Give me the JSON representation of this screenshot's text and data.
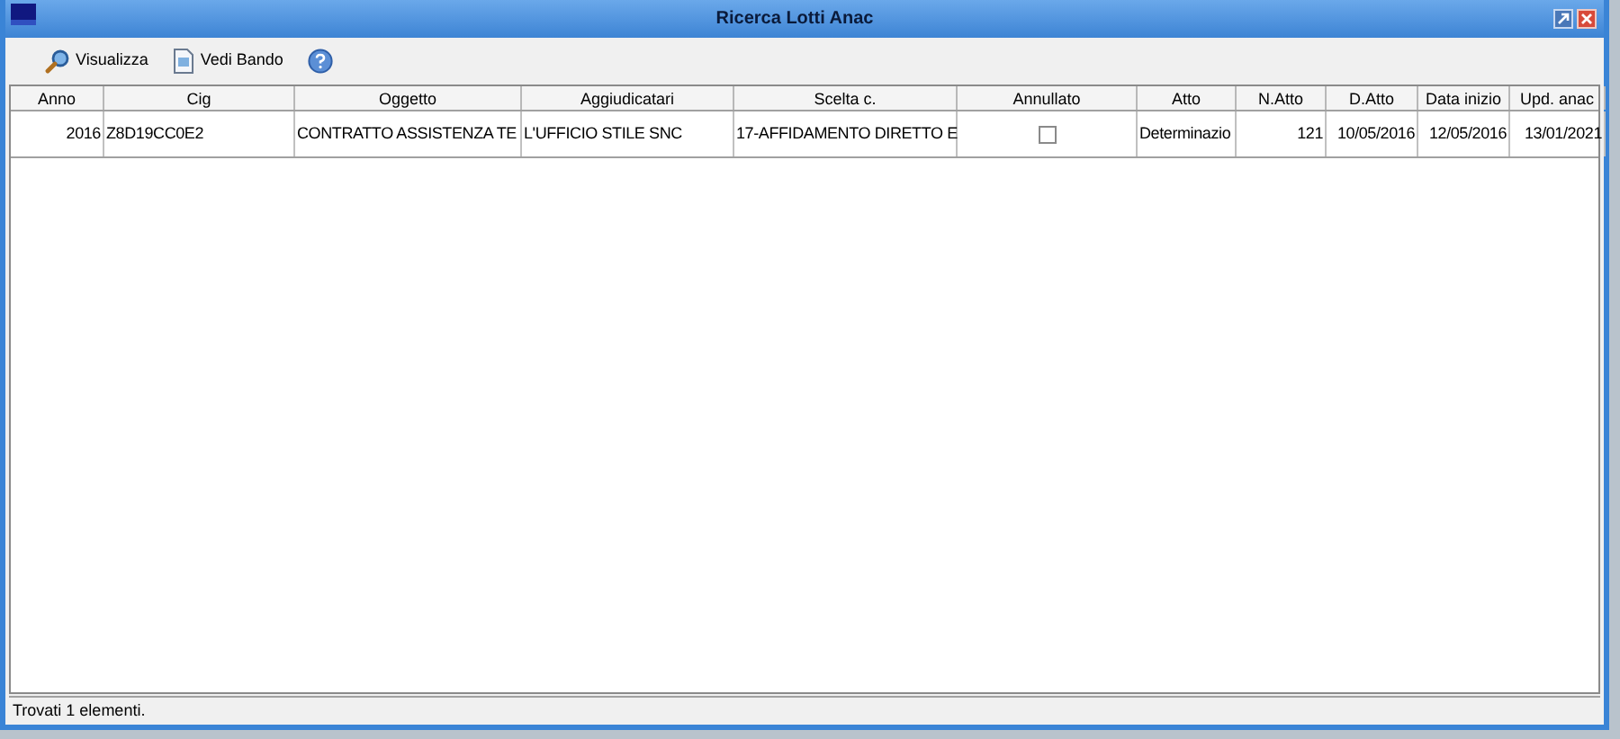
{
  "window": {
    "title": "Ricerca Lotti Anac"
  },
  "toolbar": [
    {
      "kind": "search",
      "label": "Visualizza"
    },
    {
      "kind": "document",
      "label": "Vedi Bando"
    },
    {
      "kind": "help"
    }
  ],
  "table": {
    "columns": [
      "Anno",
      "Cig",
      "Oggetto",
      "Aggiudicatari",
      "Scelta c.",
      "Annullato",
      "Atto",
      "N.Atto",
      "D.Atto",
      "Data inizio",
      "Upd. anac"
    ],
    "rows": [
      {
        "anno": "2016",
        "cig": "Z8D19CC0E2",
        "oggetto": "CONTRATTO ASSISTENZA TE",
        "aggiudicatari": "L'UFFICIO STILE SNC",
        "scelta": "17-AFFIDAMENTO DIRETTO E",
        "annullato": false,
        "atto": "Determinazio",
        "n_atto": "121",
        "d_atto": "10/05/2016",
        "data_inizio": "12/05/2016",
        "upd_anac": "13/01/2021"
      }
    ]
  },
  "status_bar": "Trovati 1 elementi."
}
